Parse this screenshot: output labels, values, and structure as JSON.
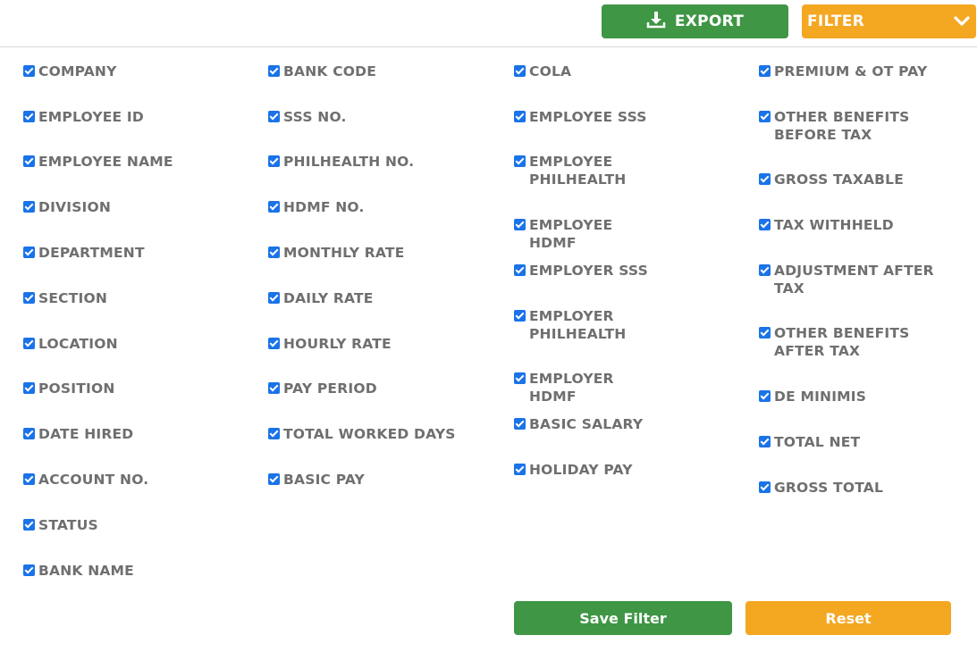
{
  "toolbar": {
    "export_label": "EXPORT",
    "filter_label": "FILTER"
  },
  "columns": [
    [
      "COMPANY",
      "EMPLOYEE ID",
      "EMPLOYEE NAME",
      "DIVISION",
      "DEPARTMENT",
      "SECTION",
      "LOCATION",
      "POSITION",
      "DATE HIRED",
      "ACCOUNT NO.",
      "STATUS",
      "BANK NAME"
    ],
    [
      "BANK CODE",
      "SSS NO.",
      "PHILHEALTH NO.",
      "HDMF NO.",
      "MONTHLY RATE",
      "DAILY RATE",
      "HOURLY RATE",
      "PAY PERIOD",
      "TOTAL WORKED DAYS",
      "BASIC PAY"
    ],
    [
      "COLA",
      "EMPLOYEE SSS",
      "EMPLOYEE PHILHEALTH",
      "EMPLOYEE HDMF",
      "EMPLOYER SSS",
      "EMPLOYER PHILHEALTH",
      "EMPLOYER HDMF",
      "BASIC SALARY",
      "HOLIDAY PAY"
    ],
    [
      "PREMIUM & OT PAY",
      "OTHER BENEFITS BEFORE TAX",
      "GROSS TAXABLE",
      "TAX WITHHELD",
      "ADJUSTMENT AFTER TAX",
      "OTHER BENEFITS AFTER TAX",
      "DE MINIMIS",
      "TOTAL NET",
      "GROSS TOTAL"
    ]
  ],
  "actions": {
    "save_label": "Save Filter",
    "reset_label": "Reset"
  },
  "colors": {
    "export": "#3f9645",
    "filter": "#f4a721",
    "checkbox": "#1a73e8"
  }
}
